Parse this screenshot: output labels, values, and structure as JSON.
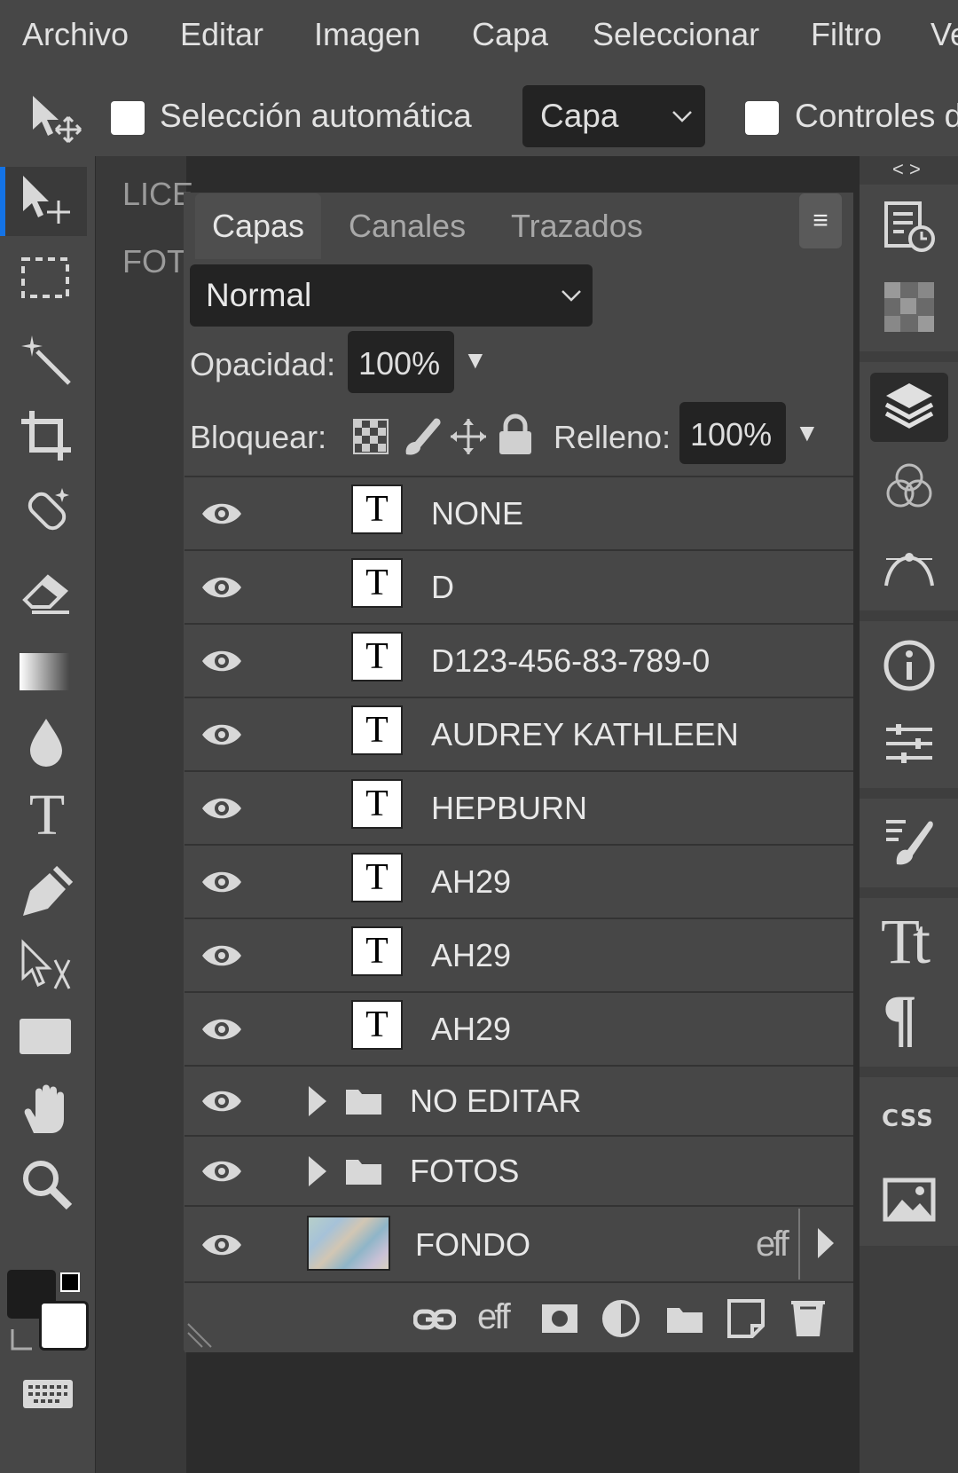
{
  "menu": [
    "Archivo",
    "Editar",
    "Imagen",
    "Capa",
    "Seleccionar",
    "Filtro",
    "Ve"
  ],
  "options": {
    "auto_select_label": "Selección automática",
    "target_dropdown": "Capa",
    "controls_label": "Controles d"
  },
  "doc_tabs": [
    "LICE",
    "FOT"
  ],
  "panel": {
    "collapse_label": "< >",
    "tabs": [
      "Capas",
      "Canales",
      "Trazados"
    ],
    "blend_mode": "Normal",
    "opacity_label": "Opacidad:",
    "opacity_value": "100%",
    "lock_label": "Bloquear:",
    "fill_label": "Relleno:",
    "fill_value": "100%",
    "menu_icon": "≡",
    "dropdown_arrow": "▼"
  },
  "layers": [
    {
      "name": "NONE",
      "type": "text",
      "thumb": "T"
    },
    {
      "name": "D",
      "type": "text",
      "thumb": "T"
    },
    {
      "name": "D123-456-83-789-0",
      "type": "text",
      "thumb": "T"
    },
    {
      "name": "AUDREY KATHLEEN",
      "type": "text",
      "thumb": "T"
    },
    {
      "name": "HEPBURN",
      "type": "text",
      "thumb": "T"
    },
    {
      "name": "AH29",
      "type": "text",
      "thumb": "T"
    },
    {
      "name": "AH29",
      "type": "text",
      "thumb": "T"
    },
    {
      "name": "AH29",
      "type": "text",
      "thumb": "T"
    },
    {
      "name": "NO EDITAR",
      "type": "group"
    },
    {
      "name": "FOTOS",
      "type": "group"
    },
    {
      "name": "FONDO",
      "type": "image",
      "effects_label": "eff"
    }
  ],
  "footer_icons": [
    "link-icon",
    "effects-icon",
    "mask-icon",
    "adjustment-icon",
    "folder-icon",
    "new-layer-icon",
    "trash-icon"
  ],
  "footer_eff": "eff",
  "right_icons": [
    "history-icon",
    "swatches-icon",
    "layers-icon",
    "channels-icon",
    "paths-icon",
    "info-icon",
    "properties-icon",
    "brush-settings-icon",
    "character-icon",
    "paragraph-icon",
    "css-icon",
    "image-icon"
  ],
  "right_text": {
    "character": "Tt",
    "paragraph": "¶",
    "css": "CSS"
  },
  "colors": {
    "foreground": "#1c1c1c",
    "background": "#ffffff",
    "accent": "#1473e6"
  }
}
